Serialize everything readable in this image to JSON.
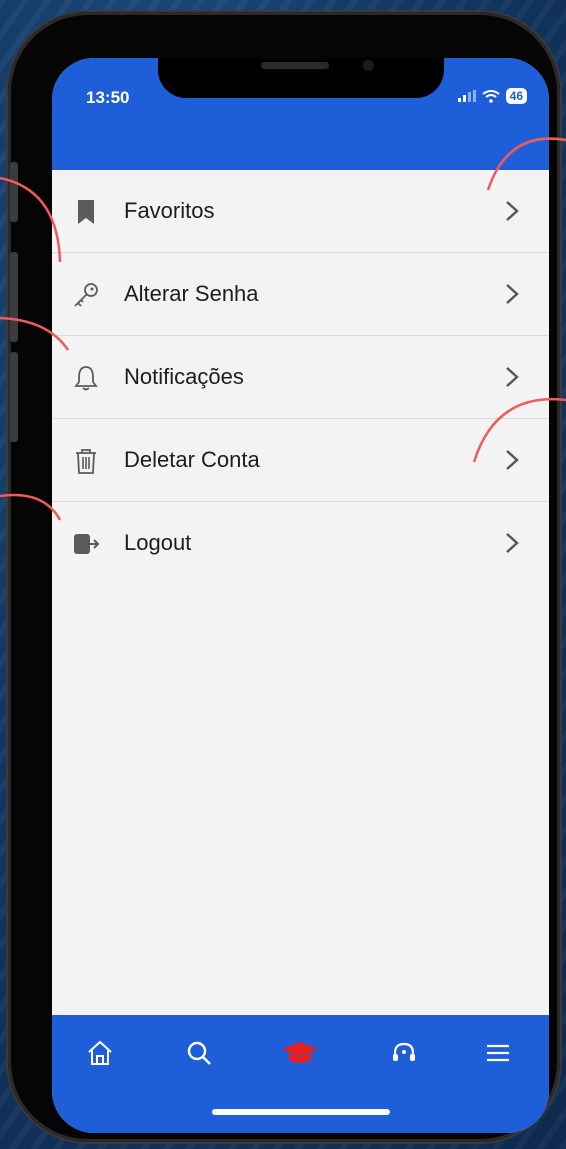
{
  "status_bar": {
    "time": "13:50",
    "battery": "46"
  },
  "menu": {
    "items": [
      {
        "label": "Favoritos",
        "icon": "bookmark-icon"
      },
      {
        "label": "Alterar Senha",
        "icon": "key-icon"
      },
      {
        "label": "Notificações",
        "icon": "bell-icon"
      },
      {
        "label": "Deletar Conta",
        "icon": "trash-icon"
      },
      {
        "label": "Logout",
        "icon": "logout-icon"
      }
    ]
  },
  "tab_bar": {
    "items": [
      {
        "icon": "home-icon"
      },
      {
        "icon": "search-icon"
      },
      {
        "icon": "graduation-cap-icon",
        "active": true
      },
      {
        "icon": "support-headset-icon"
      },
      {
        "icon": "hamburger-menu-icon"
      }
    ]
  },
  "colors": {
    "primary": "#1e5fd9",
    "active_tab": "#e5201f",
    "annotation": "#f05a5a",
    "screen_bg": "#f3f3f3"
  }
}
